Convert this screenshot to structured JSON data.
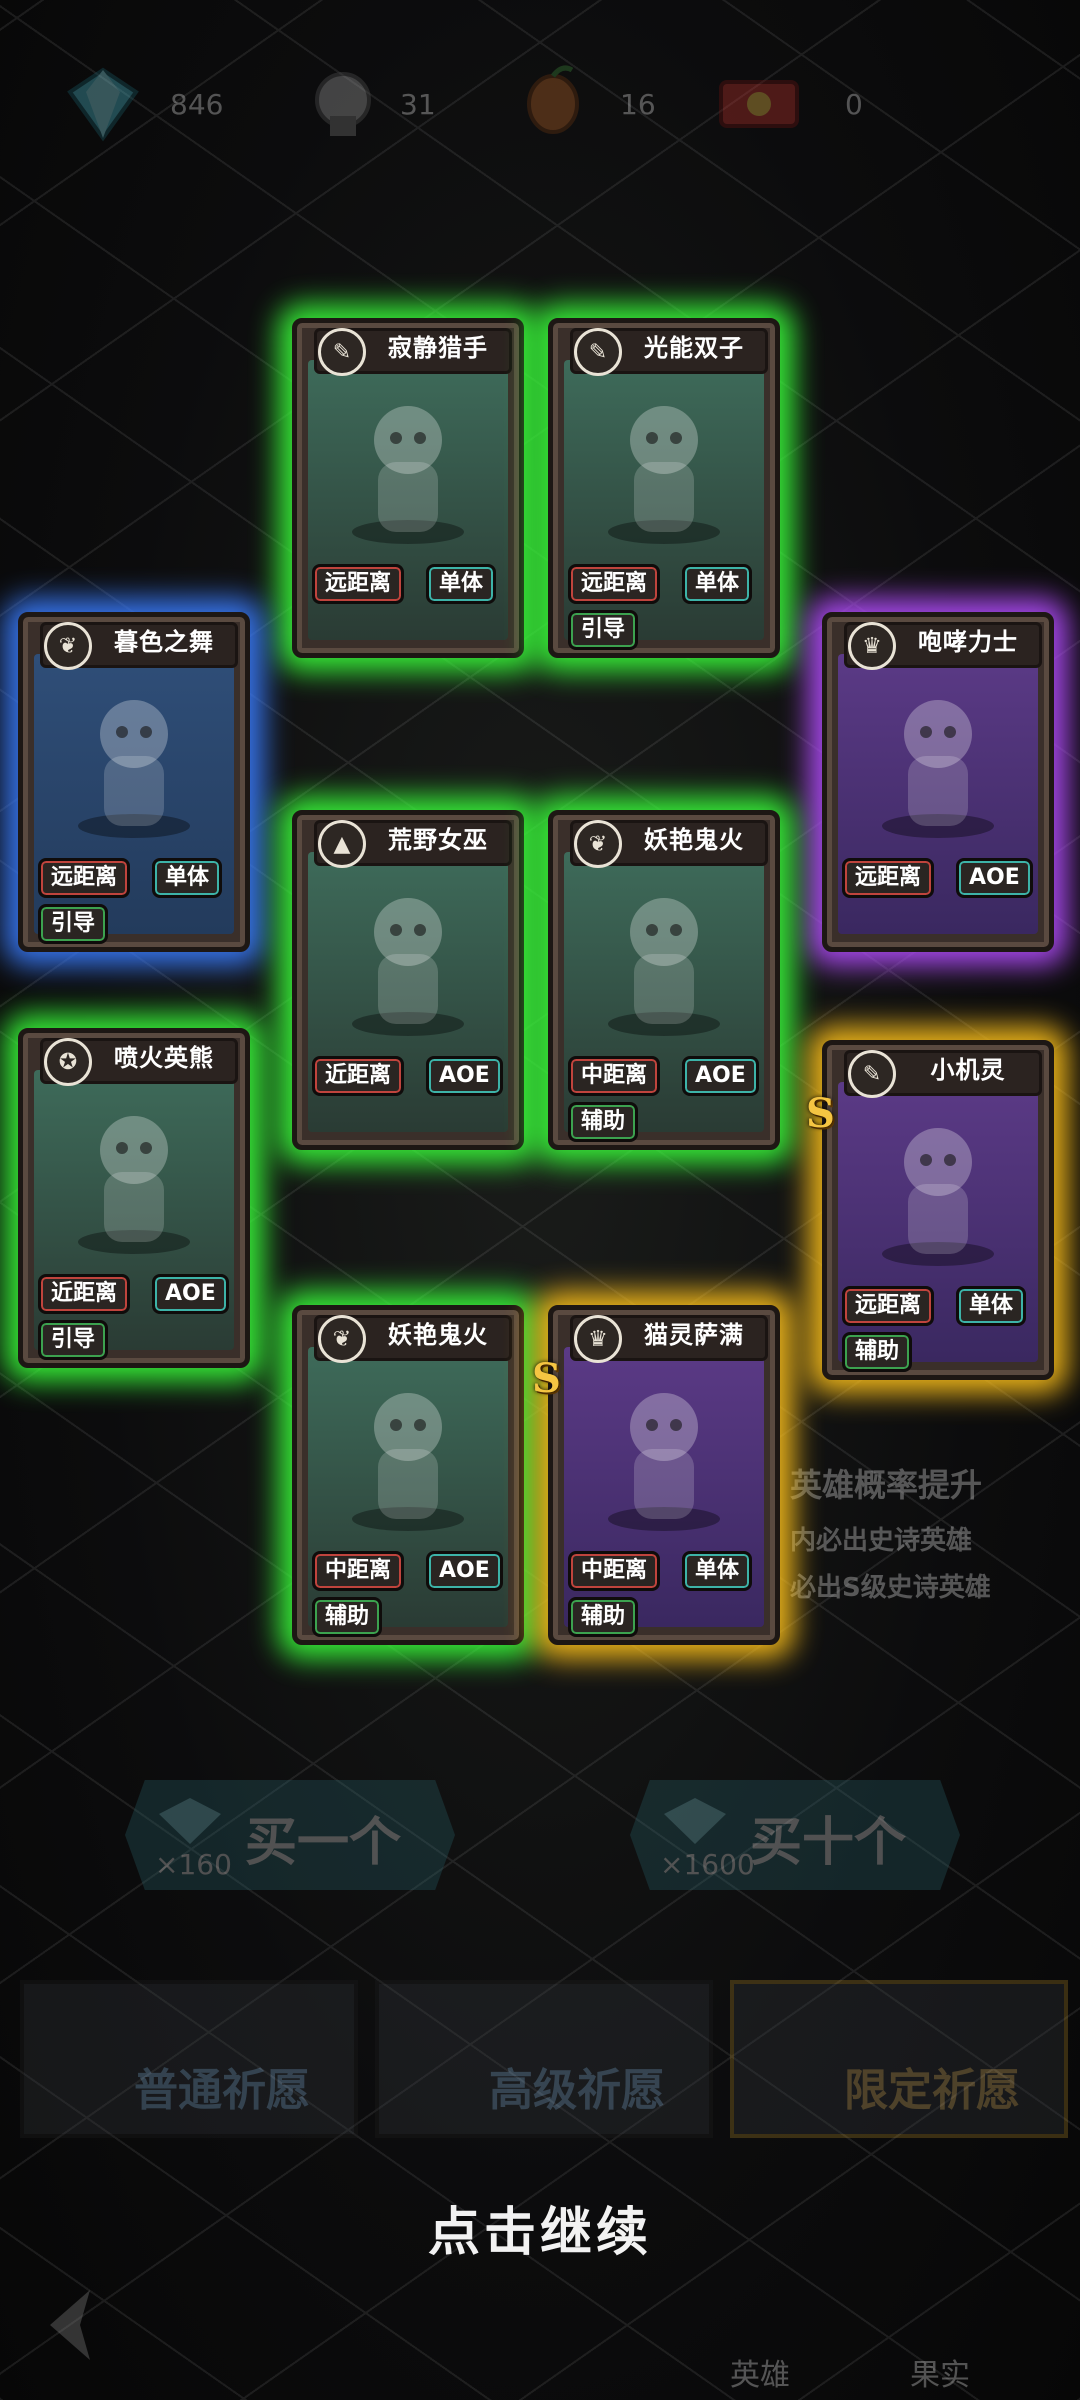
{
  "resources": [
    {
      "icon": "diamond-icon",
      "value": "846"
    },
    {
      "icon": "hero-shard-icon",
      "value": "31"
    },
    {
      "icon": "fruit-shard-icon",
      "value": "16"
    },
    {
      "icon": "ticket-icon",
      "value": "0"
    }
  ],
  "cards": [
    {
      "name": "寂静猎手",
      "rank_icon": "wrench-icon",
      "range": "远距离",
      "target": "单体",
      "support": "",
      "rarity": "green",
      "glow": "#39ff3a",
      "inner": "#3e6b5a",
      "s_badge": false
    },
    {
      "name": "光能双子",
      "rank_icon": "wrench-icon",
      "range": "远距离",
      "target": "单体",
      "support": "引导",
      "rarity": "green",
      "glow": "#39ff3a",
      "inner": "#3e6b5a",
      "s_badge": false
    },
    {
      "name": "暮色之舞",
      "rank_icon": "wing-icon",
      "range": "远距离",
      "target": "单体",
      "support": "引导",
      "rarity": "blue",
      "glow": "#3a7dff",
      "inner": "#2f4e78",
      "s_badge": false
    },
    {
      "name": "咆哮力士",
      "rank_icon": "claw-icon",
      "range": "远距离",
      "target": "AOE",
      "support": "",
      "rarity": "purple",
      "glow": "#b44dff",
      "inner": "#5b3a86",
      "s_badge": false
    },
    {
      "name": "荒野女巫",
      "rank_icon": "hat-icon",
      "range": "近距离",
      "target": "AOE",
      "support": "",
      "rarity": "green",
      "glow": "#39ff3a",
      "inner": "#3e6b5a",
      "s_badge": false
    },
    {
      "name": "妖艳鬼火",
      "rank_icon": "wing-icon",
      "range": "中距离",
      "target": "AOE",
      "support": "辅助",
      "rarity": "green",
      "glow": "#39ff3a",
      "inner": "#3e6b5a",
      "s_badge": false
    },
    {
      "name": "喷火英熊",
      "rank_icon": "crest-icon",
      "range": "近距离",
      "target": "AOE",
      "support": "引导",
      "rarity": "green",
      "glow": "#39ff3a",
      "inner": "#3e6b5a",
      "s_badge": false
    },
    {
      "name": "小机灵",
      "rank_icon": "wrench-icon",
      "range": "远距离",
      "target": "单体",
      "support": "辅助",
      "rarity": "gold",
      "glow": "#ffc21a",
      "inner": "#5b3a86",
      "s_badge": true
    },
    {
      "name": "妖艳鬼火",
      "rank_icon": "wing-icon",
      "range": "中距离",
      "target": "AOE",
      "support": "辅助",
      "rarity": "green",
      "glow": "#39ff3a",
      "inner": "#3e6b5a",
      "s_badge": false
    },
    {
      "name": "猫灵萨满",
      "rank_icon": "claw-icon",
      "range": "中距离",
      "target": "单体",
      "support": "辅助",
      "rarity": "gold",
      "glow": "#ffc21a",
      "inner": "#5b3a86",
      "s_badge": true
    }
  ],
  "s_label": "S",
  "prob": {
    "title": "英雄概率提升",
    "line1": "内必出史诗英雄",
    "line2": "必出S级史诗英雄"
  },
  "buy_one": {
    "label": "买一个",
    "cost": "×160"
  },
  "buy_ten": {
    "label": "买十个",
    "cost": "×1600"
  },
  "tabs": [
    "普通祈愿",
    "高级祈愿",
    "限定祈愿"
  ],
  "continue_text": "点击继续",
  "bottom_nav": [
    "英雄",
    "果实"
  ],
  "colors": {
    "green_glow": "#39ff3a",
    "blue_glow": "#3a7dff",
    "purple_glow": "#b44dff",
    "gold_glow": "#ffc21a"
  }
}
